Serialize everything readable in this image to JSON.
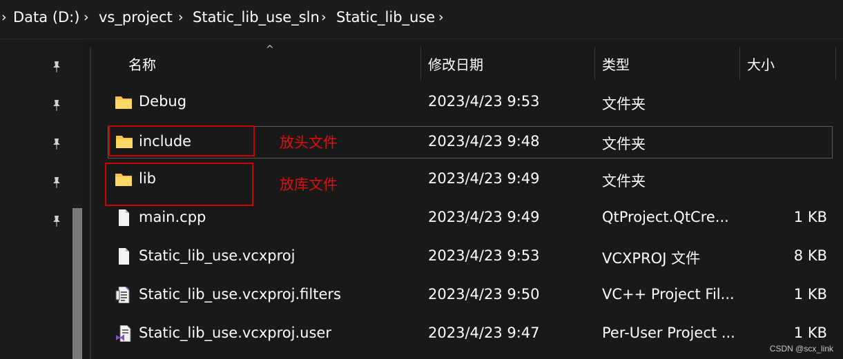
{
  "breadcrumb": [
    "Data (D:)",
    "vs_project",
    "Static_lib_use_sln",
    "Static_lib_use"
  ],
  "columns": {
    "name": "名称",
    "modified": "修改日期",
    "type": "类型",
    "size": "大小"
  },
  "rows": [
    {
      "name": "Debug",
      "modified": "2023/4/23 9:53",
      "type": "文件夹",
      "size": "",
      "icon": "folder-icon"
    },
    {
      "name": "include",
      "modified": "2023/4/23 9:48",
      "type": "文件夹",
      "size": "",
      "icon": "folder-icon"
    },
    {
      "name": "lib",
      "modified": "2023/4/23 9:49",
      "type": "文件夹",
      "size": "",
      "icon": "folder-icon"
    },
    {
      "name": "main.cpp",
      "modified": "2023/4/23 9:49",
      "type": "QtProject.QtCre...",
      "size": "1 KB",
      "icon": "file-icon"
    },
    {
      "name": "Static_lib_use.vcxproj",
      "modified": "2023/4/23 9:53",
      "type": "VCXPROJ 文件",
      "size": "8 KB",
      "icon": "file-icon"
    },
    {
      "name": "Static_lib_use.vcxproj.filters",
      "modified": "2023/4/23 9:50",
      "type": "VC++ Project Fil...",
      "size": "1 KB",
      "icon": "vcxproj-filters-icon"
    },
    {
      "name": "Static_lib_use.vcxproj.user",
      "modified": "2023/4/23 9:47",
      "type": "Per-User Project ...",
      "size": "1 KB",
      "icon": "vs-user-file-icon"
    }
  ],
  "annotations": {
    "include_note": "放头文件",
    "lib_note": "放库文件"
  },
  "watermark": "CSDN @scx_link",
  "colors": {
    "background": "#191919",
    "folder": "#f4c44e",
    "annotation": "#d10000"
  }
}
